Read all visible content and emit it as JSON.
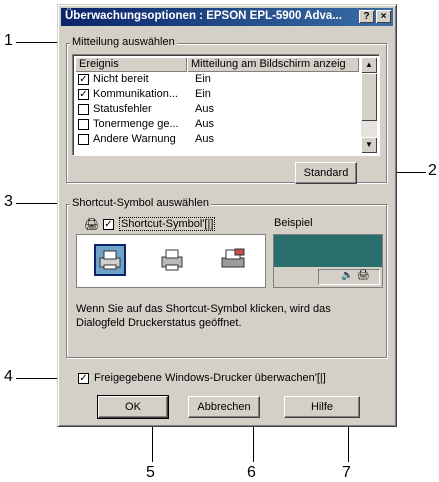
{
  "dialog": {
    "title": "Überwachungsoptionen : EPSON EPL-5900 Adva...",
    "help_button": "?",
    "close_button": "×"
  },
  "notification_group": {
    "label": "Mitteilung auswählen",
    "columns": [
      "Ereignis",
      "Mitteilung am Bildschirm anzeig"
    ],
    "rows": [
      {
        "event": "Nicht bereit",
        "value": "Ein",
        "checked": true
      },
      {
        "event": "Kommunikation...",
        "value": "Ein",
        "checked": true
      },
      {
        "event": "Statusfehler",
        "value": "Aus",
        "checked": false
      },
      {
        "event": "Tonermenge ge...",
        "value": "Aus",
        "checked": false
      },
      {
        "event": "Andere Warnung",
        "value": "Aus",
        "checked": false
      }
    ],
    "standard_button": "Standard"
  },
  "shortcut_group": {
    "label": "Shortcut-Symbol auswählen",
    "checkbox_label": "Shortcut-Symbol'[|]",
    "checkbox_checked": true,
    "example_label": "Beispiel",
    "description": "Wenn Sie auf das Shortcut-Symbol klicken, wird das Dialogfeld Druckerstatus geöffnet."
  },
  "shared_printers": {
    "label": "Freigegebene Windows-Drucker überwachen'[|]",
    "checked": true
  },
  "buttons": {
    "ok": "OK",
    "cancel": "Abbrechen",
    "help": "Hilfe"
  },
  "callouts": [
    "1",
    "2",
    "3",
    "4",
    "5",
    "6",
    "7"
  ],
  "colors": {
    "titlebar_start": "#0a246a",
    "titlebar_end": "#3a6ea5",
    "dialog_bg": "#d4d0c8",
    "example_bg": "#2a6e6e"
  }
}
